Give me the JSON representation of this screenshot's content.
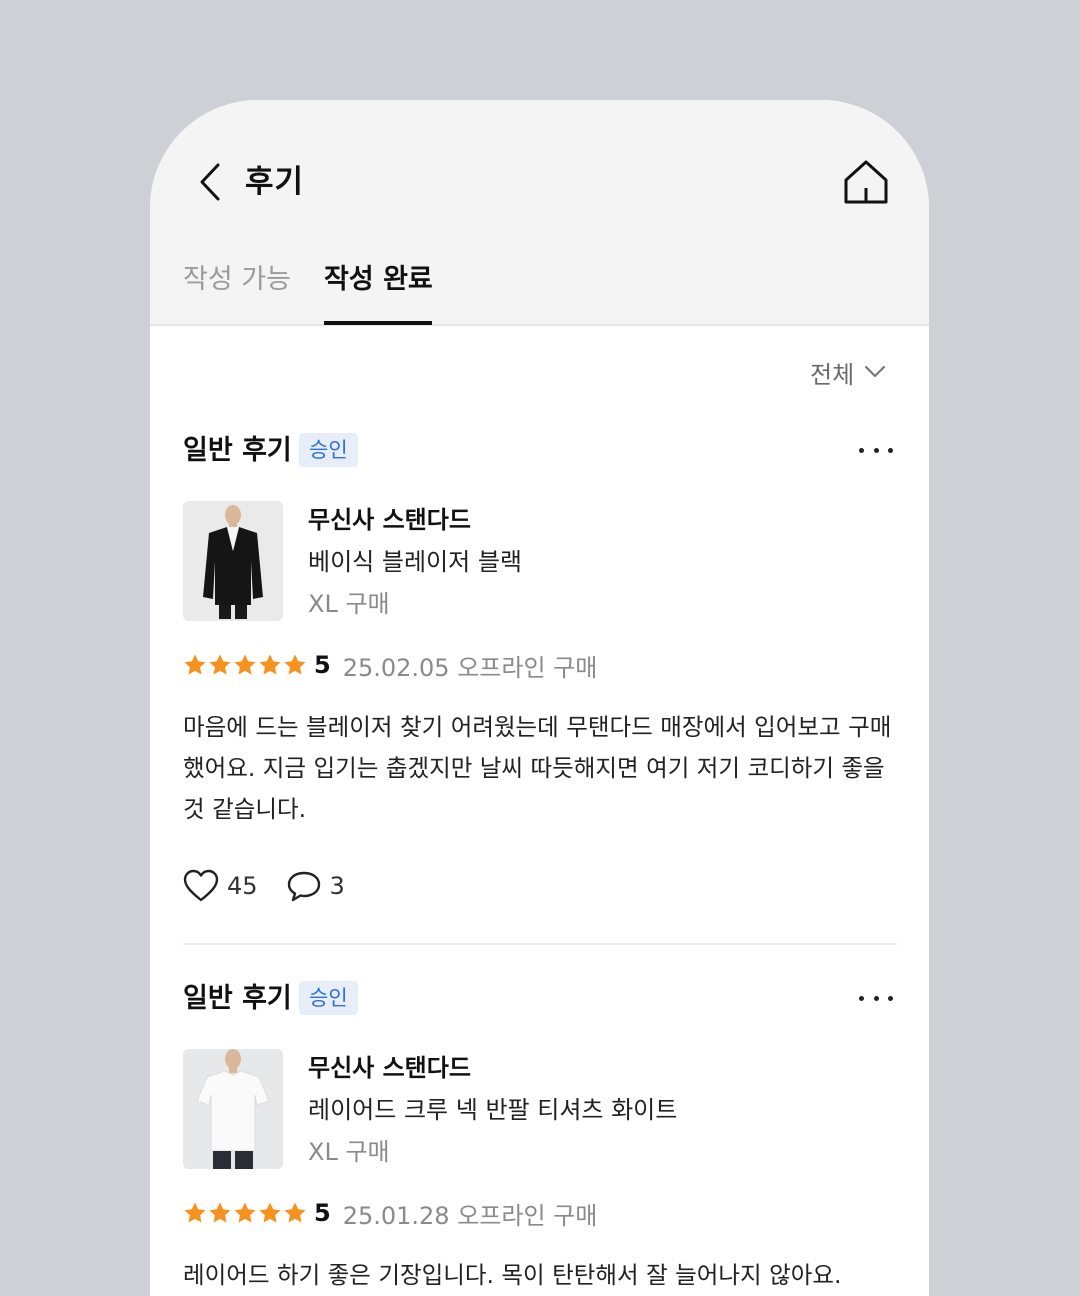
{
  "header": {
    "title": "후기",
    "back_icon": "chevron-left-icon",
    "home_icon": "home-icon"
  },
  "tabs": [
    {
      "label": "작성 가능",
      "active": false
    },
    {
      "label": "작성 완료",
      "active": true
    }
  ],
  "filter": {
    "label": "전체",
    "icon": "chevron-down-icon"
  },
  "colors": {
    "star": "#f7921e",
    "badge_bg": "#e7eef9",
    "badge_text": "#2f6fd6"
  },
  "reviews": [
    {
      "type": "일반 후기",
      "status": "승인",
      "brand": "무신사 스탠다드",
      "product": "베이식 블레이저 블랙",
      "option": "XL 구매",
      "rating": 5,
      "score_label": "5",
      "meta": "25.02.05 오프라인 구매",
      "text": "마음에 드는 블레이저 찾기 어려웠는데 무탠다드 매장에서 입어보고 구매했어요. 지금 입기는 춥겠지만 날씨 따듯해지면 여기 저기 코디하기 좋을 것 같습니다.",
      "likes": "45",
      "comments": "3"
    },
    {
      "type": "일반 후기",
      "status": "승인",
      "brand": "무신사 스탠다드",
      "product": "레이어드 크루 넥 반팔 티셔츠 화이트",
      "option": "XL 구매",
      "rating": 5,
      "score_label": "5",
      "meta": "25.01.28 오프라인 구매",
      "text": "레이어드 하기 좋은 기장입니다. 목이 탄탄해서 잘 늘어나지 않아요."
    }
  ]
}
